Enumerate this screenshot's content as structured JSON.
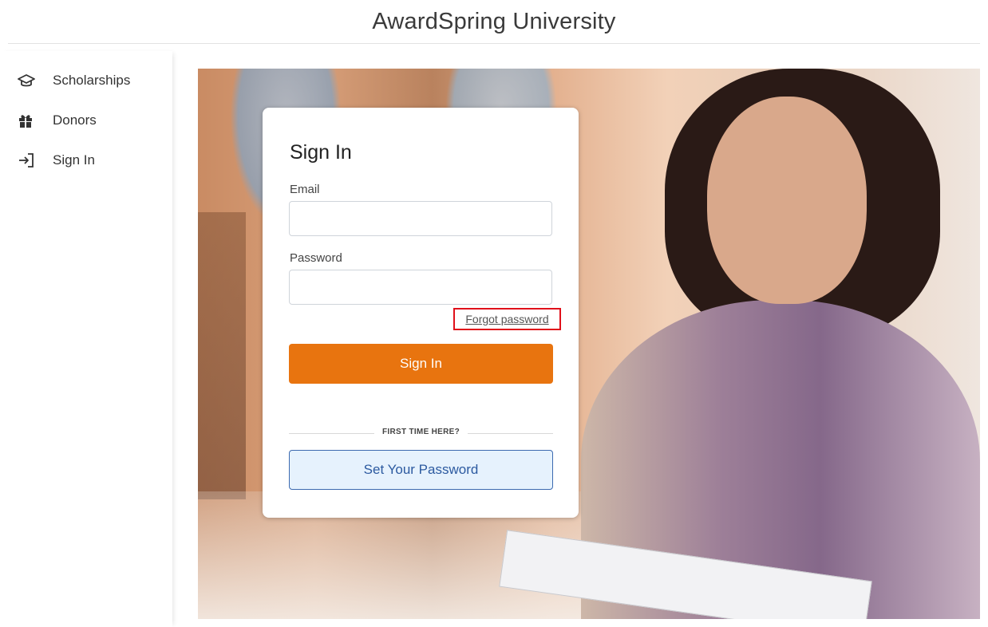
{
  "header": {
    "title": "AwardSpring University"
  },
  "sidebar": {
    "items": [
      {
        "label": "Scholarships",
        "icon": "graduation-cap-icon"
      },
      {
        "label": "Donors",
        "icon": "gift-icon"
      },
      {
        "label": "Sign In",
        "icon": "sign-in-icon"
      }
    ]
  },
  "signin": {
    "title": "Sign In",
    "email_label": "Email",
    "email_value": "",
    "password_label": "Password",
    "password_value": "",
    "forgot_label": "Forgot password",
    "submit_label": "Sign In",
    "divider_text": "FIRST TIME HERE?",
    "set_password_label": "Set Your Password"
  },
  "colors": {
    "accent_orange": "#e8740f",
    "secondary_blue": "#2c5aa0",
    "highlight_red": "#e0101a"
  }
}
